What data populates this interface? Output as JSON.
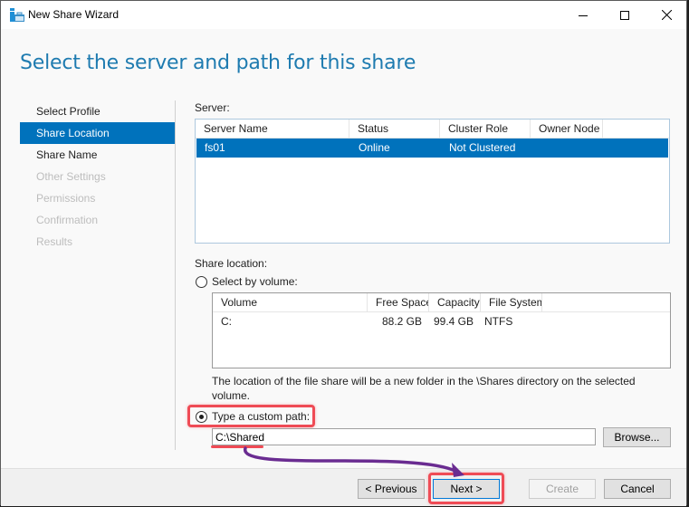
{
  "window": {
    "title": "New Share Wizard",
    "controls": {
      "minimize": "minimize",
      "maximize": "maximize",
      "close": "close"
    }
  },
  "page": {
    "heading": "Select the server and path for this share"
  },
  "nav": {
    "items": [
      {
        "label": "Select Profile",
        "state": "normal"
      },
      {
        "label": "Share Location",
        "state": "active"
      },
      {
        "label": "Share Name",
        "state": "normal"
      },
      {
        "label": "Other Settings",
        "state": "disabled"
      },
      {
        "label": "Permissions",
        "state": "disabled"
      },
      {
        "label": "Confirmation",
        "state": "disabled"
      },
      {
        "label": "Results",
        "state": "disabled"
      }
    ]
  },
  "server": {
    "label": "Server:",
    "columns": [
      "Server Name",
      "Status",
      "Cluster Role",
      "Owner Node"
    ],
    "rows": [
      {
        "server_name": "fs01",
        "status": "Online",
        "cluster_role": "Not Clustered",
        "owner_node": "",
        "selected": true
      }
    ]
  },
  "share_location": {
    "label": "Share location:",
    "select_by_volume": {
      "label": "Select by volume:",
      "checked": false
    },
    "volume_columns": [
      "Volume",
      "Free Space",
      "Capacity",
      "File System"
    ],
    "volumes": [
      {
        "volume": "C:",
        "free_space": "88.2 GB",
        "capacity": "99.4 GB",
        "file_system": "NTFS"
      }
    ],
    "note": "The location of the file share will be a new folder in the \\Shares directory on the selected volume.",
    "custom_path": {
      "label": "Type a custom path:",
      "checked": true,
      "value": "C:\\Shared"
    },
    "browse_label": "Browse..."
  },
  "footer": {
    "previous_label": "< Previous",
    "next_label": "Next >",
    "create_label": "Create",
    "cancel_label": "Cancel"
  },
  "annotations": {
    "highlight_color": "#ef4b55",
    "arrow_color": "#6a2c91"
  }
}
